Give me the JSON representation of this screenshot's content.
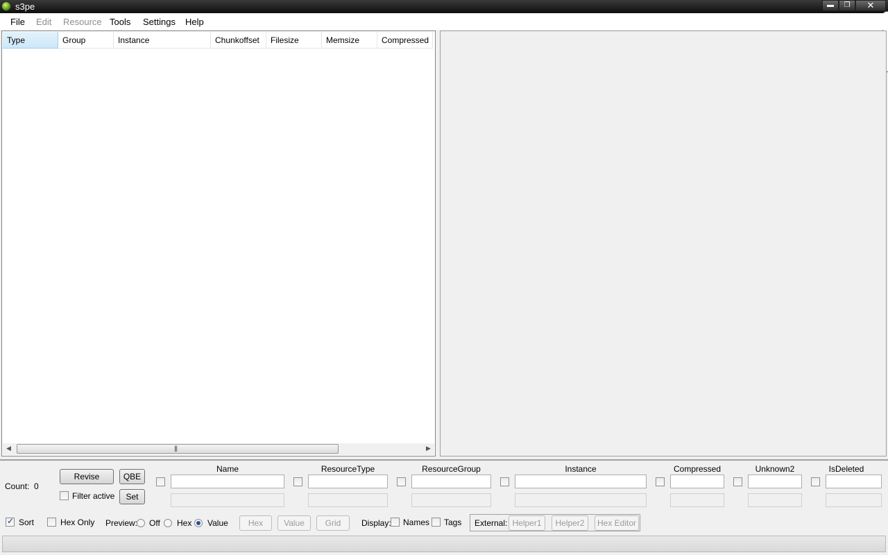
{
  "window": {
    "title": "s3pe",
    "minimize": "▬",
    "maximize": "❐",
    "close": "✕"
  },
  "menu": {
    "file": "File",
    "edit": "Edit",
    "resource": "Resource",
    "tools": "Tools",
    "settings": "Settings",
    "help": "Help"
  },
  "list": {
    "columns": [
      "Type",
      "Group",
      "Instance",
      "Chunkoffset",
      "Filesize",
      "Memsize",
      "Compressed"
    ],
    "scroll_left": "◀",
    "scroll_right": "▶",
    "grip": "|||"
  },
  "bottom": {
    "count_label": "Count:",
    "count_value": "0",
    "revise": "Revise",
    "qbe": "QBE",
    "filter_active": "Filter active",
    "set": "Set",
    "fields": [
      "Name",
      "ResourceType",
      "ResourceGroup",
      "Instance",
      "Compressed",
      "Unknown2",
      "IsDeleted"
    ],
    "sort": "Sort",
    "sort_checked": true,
    "hex_only": "Hex Only",
    "preview_label": "Preview:",
    "preview_off": "Off",
    "preview_hex": "Hex",
    "preview_value": "Value",
    "preview_selected": "Value",
    "btn_hex": "Hex",
    "btn_value": "Value",
    "btn_grid": "Grid",
    "display_label": "Display:",
    "names": "Names",
    "tags": "Tags",
    "external_label": "External:",
    "helper1": "Helper1",
    "helper2": "Helper2",
    "hex_editor": "Hex Editor"
  }
}
